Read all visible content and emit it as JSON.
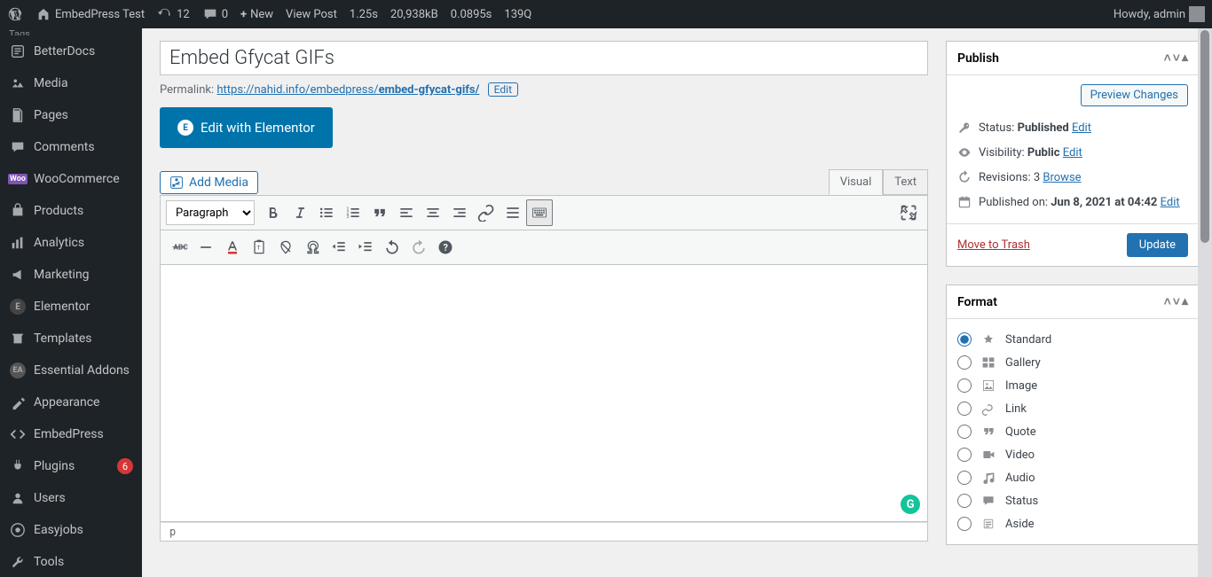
{
  "adminbar": {
    "site": "EmbedPress Test",
    "updates": "12",
    "comments": "0",
    "new": "New",
    "viewpost": "View Post",
    "qm_time": "1.25s",
    "qm_mem": "20,938kB",
    "qm_db": "0.0895s",
    "qm_q": "139Q",
    "howdy": "Howdy, admin"
  },
  "sidebar": {
    "tags_header": "Tags",
    "items": [
      {
        "label": "BetterDocs"
      },
      {
        "label": "Media"
      },
      {
        "label": "Pages"
      },
      {
        "label": "Comments"
      },
      {
        "label": "WooCommerce"
      },
      {
        "label": "Products"
      },
      {
        "label": "Analytics"
      },
      {
        "label": "Marketing"
      },
      {
        "label": "Elementor"
      },
      {
        "label": "Templates"
      },
      {
        "label": "Essential Addons"
      },
      {
        "label": "Appearance"
      },
      {
        "label": "EmbedPress"
      },
      {
        "label": "Plugins",
        "badge": "6"
      },
      {
        "label": "Users"
      },
      {
        "label": "Easyjobs"
      },
      {
        "label": "Tools"
      }
    ]
  },
  "editor": {
    "title": "Embed Gfycat GIFs",
    "permalink_label": "Permalink:",
    "permalink_base": "https://nahid.info/embedpress/",
    "permalink_slug": "embed-gfycat-gifs/",
    "permalink_edit": "Edit",
    "elementor_btn": "Edit with Elementor",
    "add_media": "Add Media",
    "tab_visual": "Visual",
    "tab_text": "Text",
    "format_select": "Paragraph",
    "path": "p"
  },
  "publish": {
    "header": "Publish",
    "preview": "Preview Changes",
    "status_label": "Status:",
    "status_value": "Published",
    "status_edit": "Edit",
    "visibility_label": "Visibility:",
    "visibility_value": "Public",
    "visibility_edit": "Edit",
    "revisions_label": "Revisions:",
    "revisions_value": "3",
    "revisions_link": "Browse",
    "published_label": "Published on:",
    "published_value": "Jun 8, 2021 at 04:42",
    "published_edit": "Edit",
    "trash": "Move to Trash",
    "update": "Update"
  },
  "format": {
    "header": "Format",
    "options": [
      {
        "label": "Standard",
        "checked": true
      },
      {
        "label": "Gallery"
      },
      {
        "label": "Image"
      },
      {
        "label": "Link"
      },
      {
        "label": "Quote"
      },
      {
        "label": "Video"
      },
      {
        "label": "Audio"
      },
      {
        "label": "Status"
      },
      {
        "label": "Aside"
      }
    ]
  }
}
